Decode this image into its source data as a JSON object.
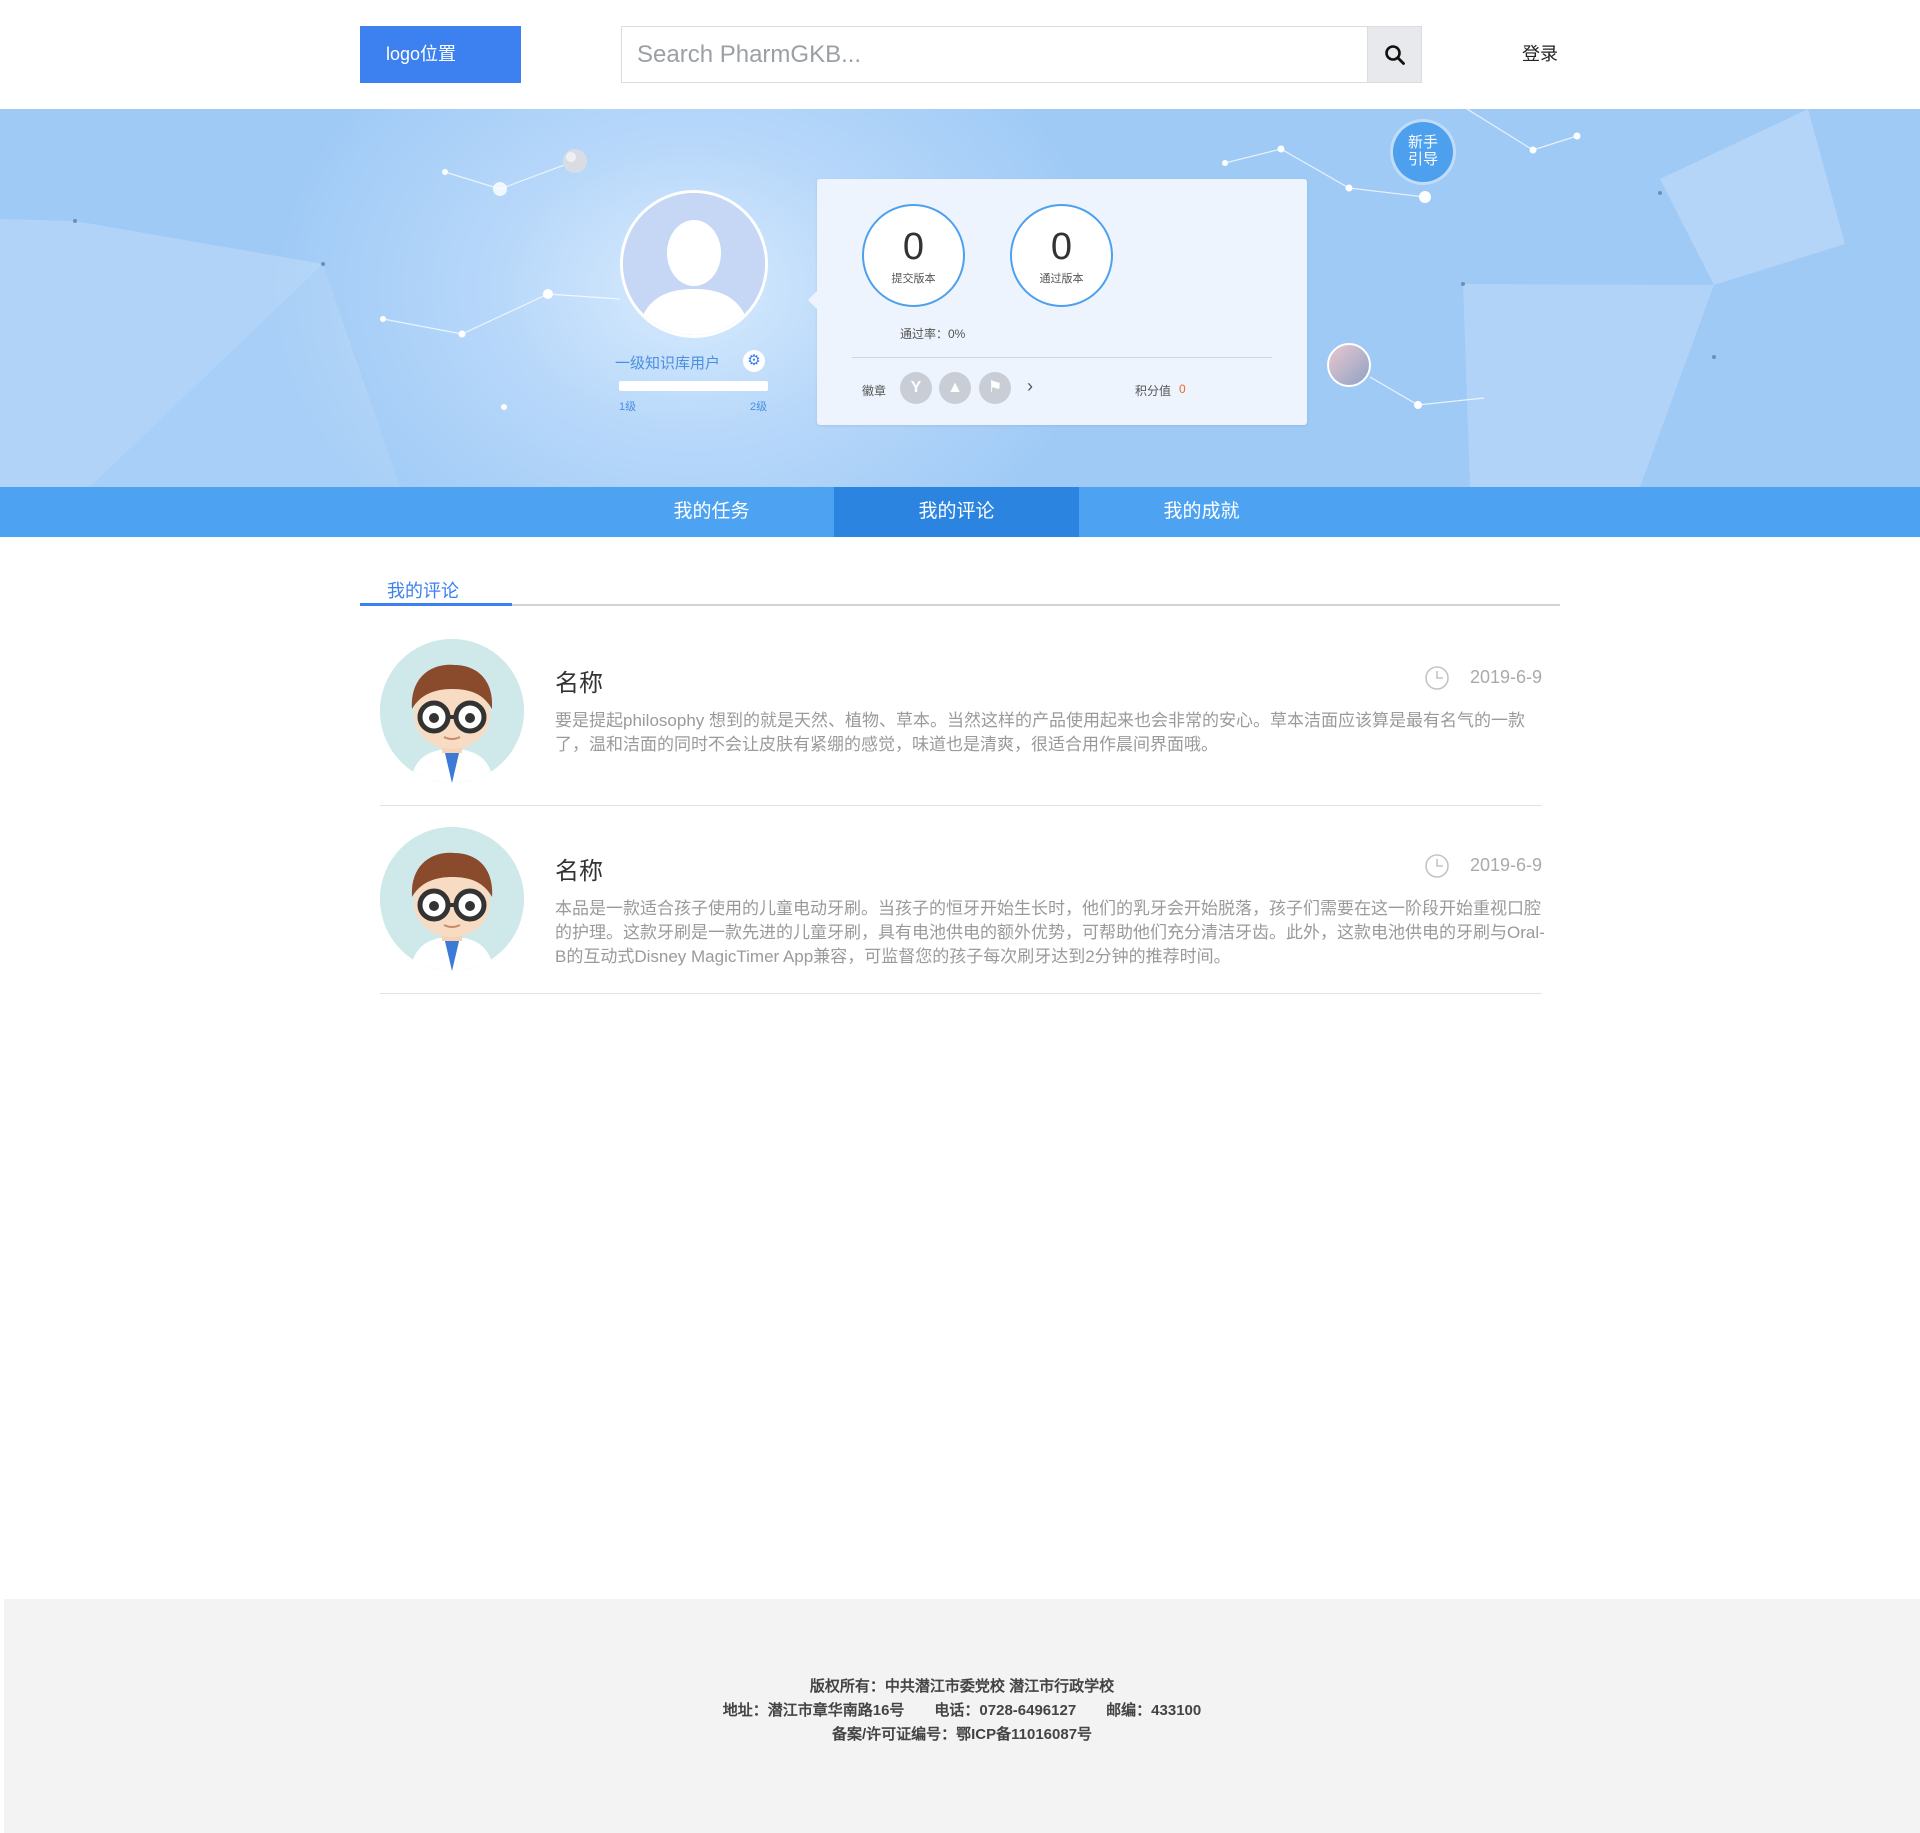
{
  "header": {
    "logo": "logo位置",
    "search_placeholder": "Search PharmGKB...",
    "login": "登录"
  },
  "profile": {
    "username": "一级知识库用户",
    "level_current": "1级",
    "level_next": "2级",
    "level_progress": 0,
    "submitted_count": "0",
    "submitted_label": "提交版本",
    "passed_count": "0",
    "passed_label": "通过版本",
    "pass_rate": "通过率：0%",
    "badges_label": "徽章",
    "points_label": "积分值",
    "points_value": "0",
    "guide_line1": "新手",
    "guide_line2": "引导"
  },
  "tabs": [
    {
      "label": "我的任务",
      "active": false
    },
    {
      "label": "我的评论",
      "active": true
    },
    {
      "label": "我的成就",
      "active": false
    }
  ],
  "section": {
    "title": "我的评论"
  },
  "comments": [
    {
      "name": "名称",
      "date": "2019-6-9",
      "text": "要是提起philosophy 想到的就是天然、植物、草本。当然这样的产品使用起来也会非常的安心。草本洁面应该算是最有名气的一款了，温和洁面的同时不会让皮肤有紧绷的感觉，味道也是清爽，很适合用作晨间界面哦。"
    },
    {
      "name": "名称",
      "date": "2019-6-9",
      "text": "本品是一款适合孩子使用的儿童电动牙刷。当孩子的恒牙开始生长时，他们的乳牙会开始脱落，孩子们需要在这一阶段开始重视口腔的护理。这款牙刷是一款先进的儿童牙刷，具有电池供电的额外优势，可帮助他们充分清洁牙齿。此外，这款电池供电的牙刷与Oral-B的互动式Disney MagicTimer App兼容，可监督您的孩子每次刷牙达到2分钟的推荐时间。"
    }
  ],
  "footer": {
    "line1": "版权所有：中共潜江市委党校 潜江市行政学校",
    "line2": "地址：潜江市章华南路16号　　电话：0728-6496127　　邮编：433100",
    "line3": "备案/许可证编号：鄂ICP备11016087号"
  },
  "colors": {
    "primary": "#3d80ef",
    "tab_bar": "#4da3f1",
    "tab_active": "#2b84df",
    "points": "#f06a1c"
  },
  "icons": [
    "search-icon",
    "gear-icon",
    "clock-icon",
    "chevron-right-icon",
    "badge-icon"
  ]
}
